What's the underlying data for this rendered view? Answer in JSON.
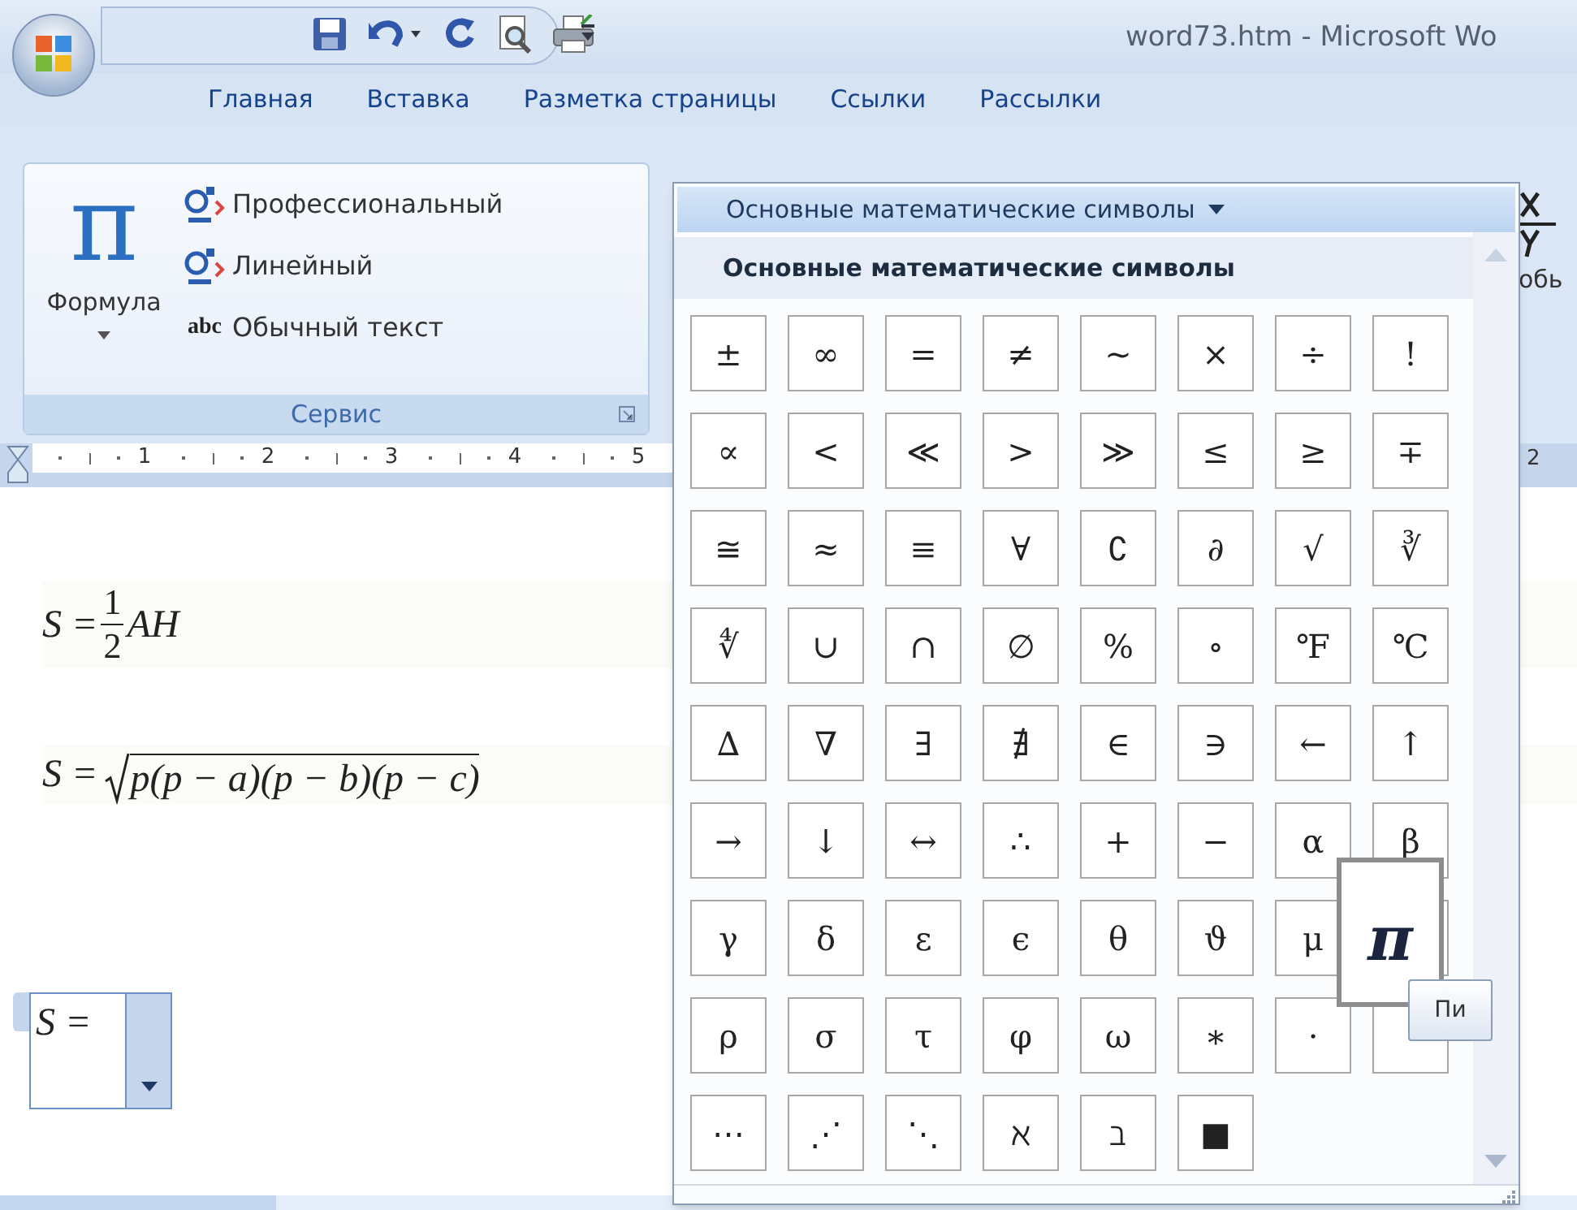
{
  "window": {
    "title": "word73.htm - Microsoft Wo"
  },
  "tabs": [
    {
      "label": "Главная",
      "selected": false
    },
    {
      "label": "Вставка",
      "selected": false
    },
    {
      "label": "Разметка страницы",
      "selected": false
    },
    {
      "label": "Ссылки",
      "selected": false
    },
    {
      "label": "Рассылки",
      "selected": false
    }
  ],
  "ribbon": {
    "group": {
      "label": "Сервис",
      "big_button": {
        "symbol": "π",
        "label": "Формула"
      },
      "items": [
        {
          "kind": "eq",
          "label": "Профессиональный"
        },
        {
          "kind": "eq",
          "label": "Линейный"
        },
        {
          "kind": "abc",
          "icon_text": "abc",
          "label": "Обычный текст"
        }
      ]
    },
    "right_partial_label": "обь"
  },
  "ruler": {
    "labels": [
      "1",
      "2",
      "3",
      "4",
      "5"
    ],
    "right_label": "2"
  },
  "document": {
    "equations": [
      {
        "kind": "fraction",
        "lhs": "S =",
        "numerator": "1",
        "denominator": "2",
        "rest": "AH"
      },
      {
        "kind": "sqrt",
        "lhs": "S =",
        "radicand": "p(p − a)(p − b)(p − c)"
      }
    ],
    "equation_box": {
      "text": "S ="
    }
  },
  "gallery": {
    "header": "Основные математические символы",
    "section": "Основные математические символы",
    "rows": [
      {
        "symbols": [
          "±",
          "∞",
          "=",
          "≠",
          "~",
          "×",
          "÷",
          "!"
        ],
        "trailing_blank": false
      },
      {
        "symbols": [
          "∝",
          "<",
          "≪",
          ">",
          "≫",
          "≤",
          "≥",
          "∓"
        ],
        "trailing_blank": false
      },
      {
        "symbols": [
          "≅",
          "≈",
          "≡",
          "∀",
          "∁",
          "∂",
          "√",
          "∛"
        ],
        "trailing_blank": false
      },
      {
        "symbols": [
          "∜",
          "∪",
          "∩",
          "∅",
          "%",
          "∘",
          "℉",
          "℃"
        ],
        "trailing_blank": false
      },
      {
        "symbols": [
          "∆",
          "∇",
          "∃",
          "∄",
          "∈",
          "∋",
          "←",
          "↑"
        ],
        "trailing_blank": false
      },
      {
        "symbols": [
          "→",
          "↓",
          "↔",
          "∴",
          "+",
          "−",
          "α",
          "β"
        ],
        "trailing_blank": false
      },
      {
        "symbols": [
          "γ",
          "δ",
          "ε",
          "ϵ",
          "θ",
          "ϑ",
          "μ"
        ],
        "trailing_blank": true
      },
      {
        "symbols": [
          "ρ",
          "σ",
          "τ",
          "φ",
          "ω",
          "∗",
          "⋅"
        ],
        "trailing_blank": true
      },
      {
        "symbols": [
          "⋯",
          "⋰",
          "⋱",
          "ℵ",
          "ℶ",
          "■"
        ],
        "trailing_blank": false
      }
    ],
    "preview": {
      "symbol": "π",
      "tooltip": "Пи"
    }
  }
}
